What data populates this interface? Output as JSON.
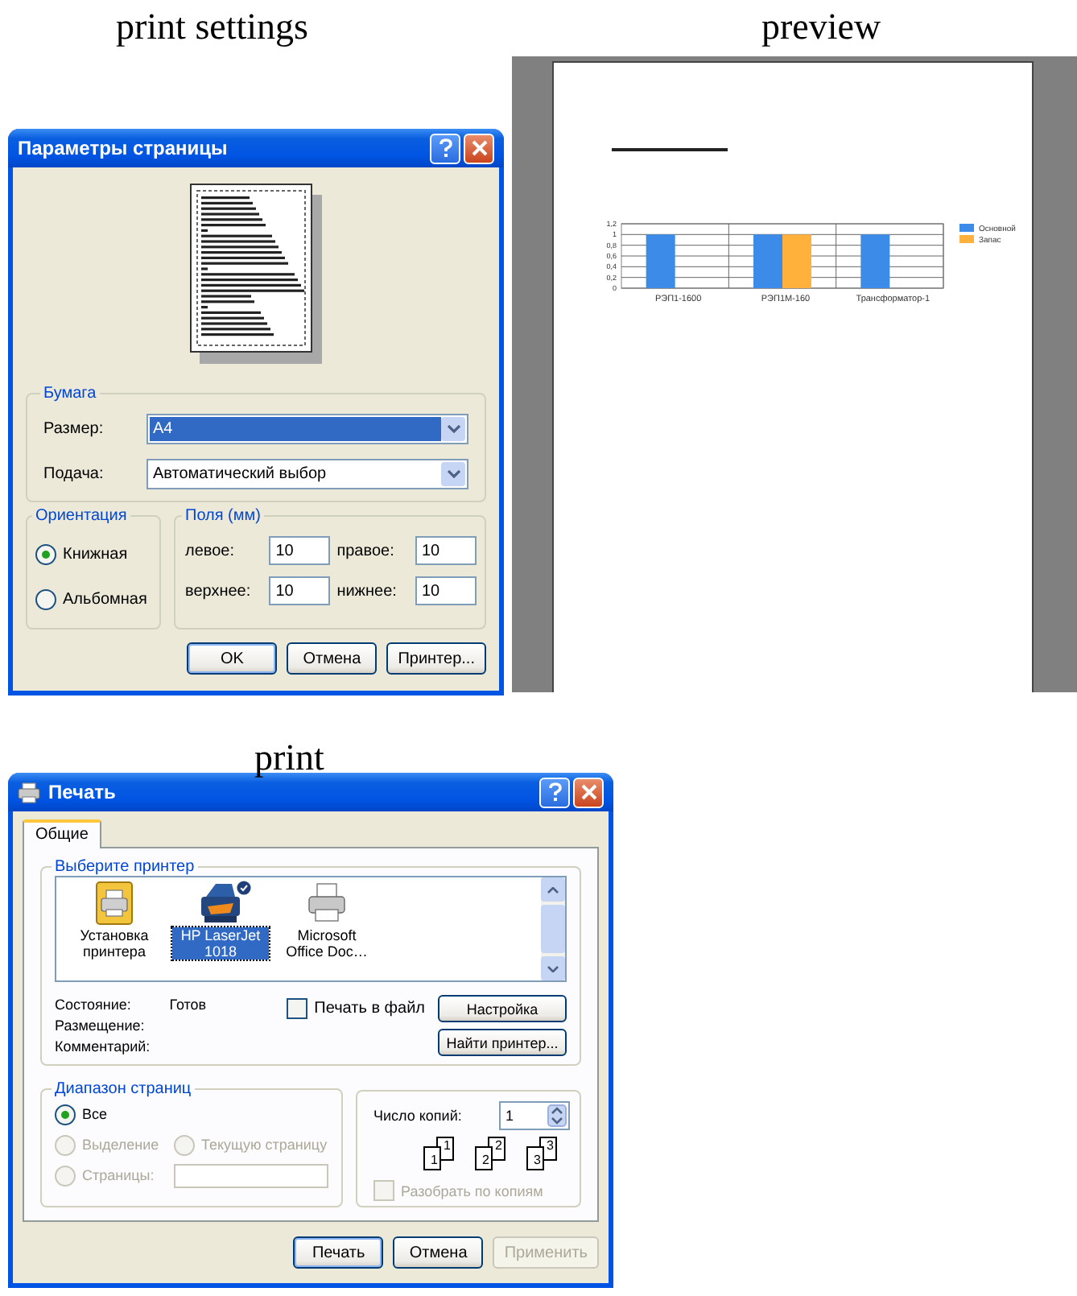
{
  "page_setup": {
    "caption": "print settings",
    "title": "Параметры страницы",
    "paper": {
      "legend": "Бумага",
      "size": {
        "label": "Размер:",
        "value": "A4",
        "selected": true
      },
      "source": {
        "label": "Подача:",
        "value": "Автоматический выбор",
        "selected": false
      }
    },
    "orientation": {
      "legend": "Ориентация",
      "options": [
        {
          "label": "Книжная",
          "selected": true
        },
        {
          "label": "Альбомная",
          "selected": false
        }
      ]
    },
    "margins": {
      "legend": "Поля (мм)",
      "fields": [
        {
          "label": "левое:",
          "value": "10"
        },
        {
          "label": "правое:",
          "value": "10"
        },
        {
          "label": "верхнее:",
          "value": "10"
        },
        {
          "label": "нижнее:",
          "value": "10"
        }
      ]
    },
    "buttons": [
      {
        "label": "OK",
        "default": true
      },
      {
        "label": "Отмена",
        "default": false
      },
      {
        "label": "Принтер...",
        "default": false
      }
    ]
  },
  "preview": {
    "caption": "preview",
    "chart_data": {
      "type": "bar",
      "categories": [
        "РЭП1-1600",
        "РЭП1М-160",
        "Трансформатор-1"
      ],
      "series": [
        {
          "name": "Основной",
          "color": "#3d8be8",
          "values": [
            1,
            1,
            1
          ]
        },
        {
          "name": "Запас",
          "color": "#ffb13c",
          "values": [
            null,
            1,
            null
          ]
        }
      ],
      "grid": true,
      "legend": true,
      "ylim": [
        0,
        1.2
      ],
      "yticks": [
        {
          "value": 0,
          "label": "0"
        },
        {
          "value": 0.2,
          "label": "0,2"
        },
        {
          "value": 0.4,
          "label": "0,4"
        },
        {
          "value": 0.6,
          "label": "0,6"
        },
        {
          "value": 0.8,
          "label": "0,8"
        },
        {
          "value": 1,
          "label": "1"
        },
        {
          "value": 1.2,
          "label": "1,2"
        }
      ]
    }
  },
  "print": {
    "caption": "print",
    "title": "Печать",
    "tabs": [
      {
        "label": "Общие",
        "selected": true
      }
    ],
    "printer_group": {
      "legend": "Выберите принтер",
      "printers": [
        {
          "kind": "setup",
          "label": "Установка принтера",
          "selected": false,
          "default": false
        },
        {
          "kind": "laser",
          "label": "HP LaserJet 1018",
          "selected": true,
          "default": true
        },
        {
          "kind": "printer",
          "label": "Microsoft Office Doc…",
          "selected": false,
          "default": false
        }
      ],
      "status": [
        {
          "label": "Состояние:",
          "value": "Готов"
        },
        {
          "label": "Размещение:"
        },
        {
          "label": "Комментарий:"
        }
      ],
      "print_to_file": {
        "label": "Печать в файл",
        "checked": false
      },
      "buttons": [
        "Настройка",
        "Найти принтер..."
      ]
    },
    "range": {
      "legend": "Диапазон страниц",
      "options": [
        {
          "label": "Все",
          "selected": true,
          "disabled": false
        },
        {
          "label": "Выделение",
          "selected": false,
          "disabled": true
        },
        {
          "label": "Текущую страницу",
          "selected": false,
          "disabled": true
        },
        {
          "label": "Страницы:",
          "selected": false,
          "disabled": true
        }
      ]
    },
    "copies": {
      "label": "Число копий:",
      "value": "1",
      "collate_pages": [
        [
          "1",
          "1"
        ],
        [
          "2",
          "2"
        ],
        [
          "3",
          "3"
        ]
      ],
      "collate": {
        "label": "Разобрать по копиям",
        "checked": false,
        "disabled": true
      }
    },
    "buttons": [
      {
        "label": "Печать",
        "disabled": false
      },
      {
        "label": "Отмена",
        "disabled": false
      },
      {
        "label": "Применить",
        "disabled": true
      }
    ]
  }
}
